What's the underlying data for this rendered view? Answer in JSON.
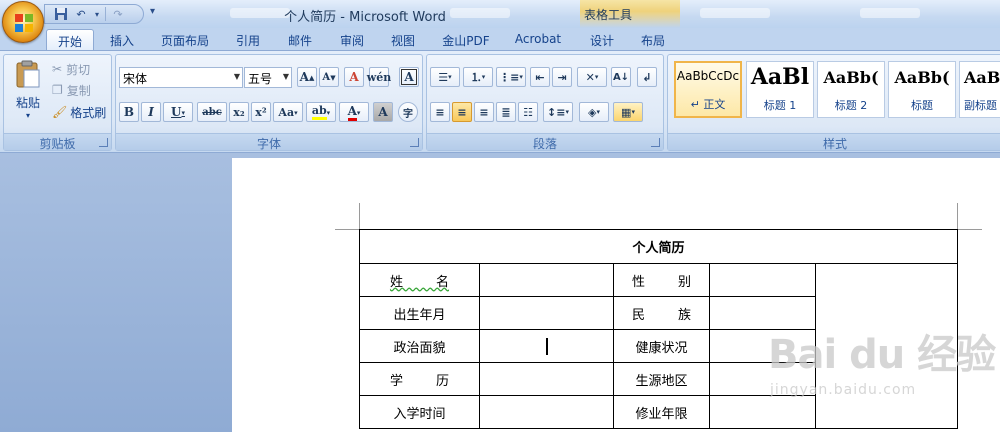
{
  "window": {
    "title": "个人简历 - Microsoft Word",
    "context_tools": "表格工具"
  },
  "tabs": [
    {
      "label": "开始",
      "active": true
    },
    {
      "label": "插入"
    },
    {
      "label": "页面布局"
    },
    {
      "label": "引用"
    },
    {
      "label": "邮件"
    },
    {
      "label": "审阅"
    },
    {
      "label": "视图"
    },
    {
      "label": "金山PDF"
    },
    {
      "label": "Acrobat"
    },
    {
      "label": "设计"
    },
    {
      "label": "布局"
    }
  ],
  "clipboard": {
    "label": "剪贴板",
    "paste": "粘贴",
    "cut": "剪切",
    "copy": "复制",
    "format_painter": "格式刷"
  },
  "font": {
    "label": "字体",
    "font_name": "宋体",
    "font_size": "五号",
    "bold": "B",
    "italic": "I",
    "underline": "U",
    "strike": "abc",
    "subscript": "x₂",
    "superscript": "x²",
    "change_case": "Aa",
    "grow": "A",
    "shrink": "A",
    "clear": "A",
    "phonetic": "A",
    "char_border": "A",
    "highlight": "ab",
    "font_color": "A",
    "char_shading": "A",
    "enclose": "字"
  },
  "paragraph": {
    "label": "段落"
  },
  "styles": {
    "label": "样式",
    "items": [
      {
        "sample": "AaBbCcDc",
        "name": "↵ 正文",
        "active": true
      },
      {
        "sample": "AaBl",
        "name": "标题 1"
      },
      {
        "sample": "AaBb(",
        "name": "标题 2"
      },
      {
        "sample": "AaBb(",
        "name": "标题"
      },
      {
        "sample": "AaBl",
        "name": "副标题"
      }
    ]
  },
  "resume": {
    "title": "个人简历",
    "rows": [
      [
        "姓        名",
        "",
        "性        别",
        ""
      ],
      [
        "出生年月",
        "",
        "民        族",
        ""
      ],
      [
        "政治面貌",
        "",
        "健康状况",
        ""
      ],
      [
        "学        历",
        "",
        "生源地区",
        ""
      ],
      [
        "入学时间",
        "",
        "修业年限",
        ""
      ]
    ]
  },
  "watermark": {
    "text": "Bai du 经验",
    "url": "jingyan.baidu.com"
  },
  "colors": {
    "ribbon": "#dbe7f6",
    "active_style_border": "#f0b54a",
    "font_color_bar": "#e00000",
    "highlight_bar": "#ffff00"
  }
}
